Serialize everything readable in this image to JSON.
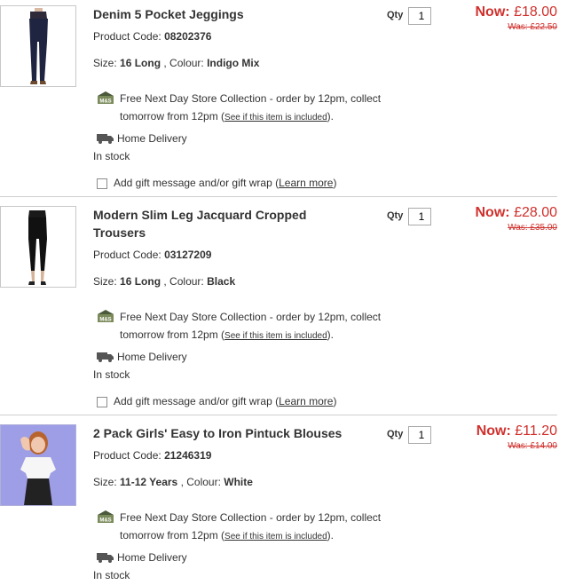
{
  "items": [
    {
      "title": "Denim 5 Pocket Jeggings",
      "code_label": "Product Code:",
      "code": "08202376",
      "size_label": "Size:",
      "size": "16 Long",
      "colour_label": ", Colour:",
      "colour": "Indigo Mix",
      "qty_label": "Qty",
      "qty": "1",
      "now_label": "Now:",
      "now_price": "£18.00",
      "was_label": "Was:",
      "was_price": "£22.50",
      "collect_text": "Free Next Day Store Collection - order by 12pm, collect tomorrow from 12pm (",
      "collect_link": "See if this item is included",
      "collect_end": ").",
      "delivery_text": "Home Delivery",
      "stock_text": "In stock",
      "gift_text": "Add gift message and/or gift wrap (",
      "gift_link": "Learn more",
      "gift_end": ")",
      "thumb_icon": "jeggings-image"
    },
    {
      "title": "Modern Slim Leg Jacquard Cropped Trousers",
      "code_label": "Product Code:",
      "code": "03127209",
      "size_label": "Size:",
      "size": "16 Long",
      "colour_label": ", Colour:",
      "colour": "Black",
      "qty_label": "Qty",
      "qty": "1",
      "now_label": "Now:",
      "now_price": "£28.00",
      "was_label": "Was:",
      "was_price": "£35.00",
      "collect_text": "Free Next Day Store Collection - order by 12pm, collect tomorrow from 12pm (",
      "collect_link": "See if this item is included",
      "collect_end": ").",
      "delivery_text": "Home Delivery",
      "stock_text": "In stock",
      "gift_text": "Add gift message and/or gift wrap (",
      "gift_link": "Learn more",
      "gift_end": ")",
      "thumb_icon": "trousers-image"
    },
    {
      "title": "2 Pack Girls' Easy to Iron Pintuck Blouses",
      "code_label": "Product Code:",
      "code": "21246319",
      "size_label": "Size:",
      "size": "11-12 Years",
      "colour_label": ", Colour:",
      "colour": "White",
      "qty_label": "Qty",
      "qty": "1",
      "now_label": "Now:",
      "now_price": "£11.20",
      "was_label": "Was:",
      "was_price": "£14.00",
      "collect_text": "Free Next Day Store Collection - order by 12pm, collect tomorrow from 12pm (",
      "collect_link": "See if this item is included",
      "collect_end": ").",
      "delivery_text": "Home Delivery",
      "stock_text": "In stock",
      "thumb_icon": "blouse-image"
    }
  ],
  "colors": {
    "price_red": "#d0312d",
    "text": "#333333",
    "divider": "#cfcfcf",
    "blouse_bg": "#9d9ee6"
  },
  "icons": {
    "collection": "ms-store-collection-icon",
    "delivery": "delivery-van-icon"
  },
  "collection_badge": "M&S"
}
